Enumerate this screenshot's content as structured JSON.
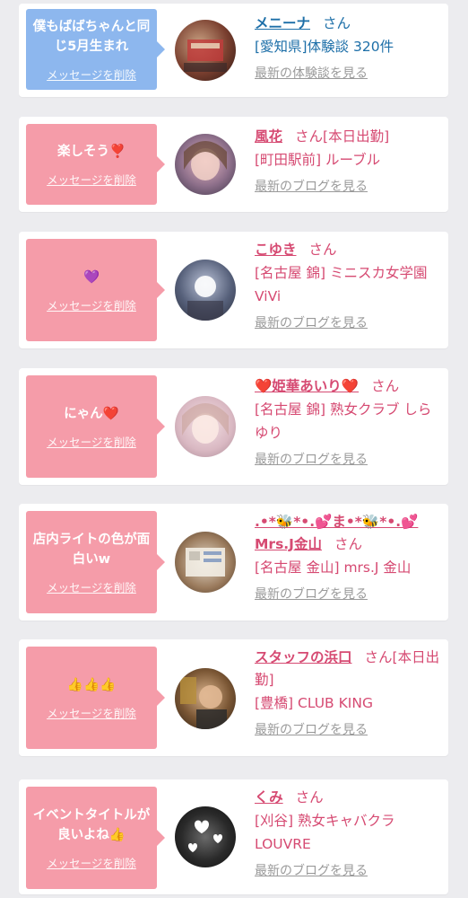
{
  "cards": [
    {
      "message": "僕もばばちゃんと同じ5月生まれ",
      "delete_label": "メッセージを削除",
      "name": "メニーナ",
      "honorific": "さん",
      "shop": "[愛知県]体験談 320件",
      "latest_link": "最新の体験談を見る"
    },
    {
      "message": "楽しそう❣️",
      "delete_label": "メッセージを削除",
      "name": "風花",
      "honorific": "さん[本日出勤]",
      "shop": "[町田駅前] ルーブル",
      "latest_link": "最新のブログを見る"
    },
    {
      "message": "💜",
      "delete_label": "メッセージを削除",
      "name": "こゆき",
      "honorific": "さん",
      "shop": "[名古屋 錦] ミニスカ女学園ViVi",
      "latest_link": "最新のブログを見る"
    },
    {
      "message": "にゃん❤️",
      "delete_label": "メッセージを削除",
      "name": "❤️姫華あいり❤️",
      "honorific": "さん",
      "shop": "[名古屋 錦] 熟女クラブ しらゆり",
      "latest_link": "最新のブログを見る"
    },
    {
      "message": "店内ライトの色が面白いw",
      "delete_label": "メッセージを削除",
      "name": ".•*🐝*•.💕ま•*🐝*•.💕 Mrs.J金山",
      "honorific": "さん",
      "shop": "[名古屋 金山] mrs.J 金山",
      "latest_link": "最新のブログを見る"
    },
    {
      "message": "👍👍👍",
      "delete_label": "メッセージを削除",
      "name": "スタッフの浜口",
      "honorific": "さん[本日出勤]",
      "shop": "[豊橋] CLUB KING",
      "latest_link": "最新のブログを見る"
    },
    {
      "message": "イベントタイトルが良いよね👍",
      "delete_label": "メッセージを削除",
      "name": "くみ",
      "honorific": "さん",
      "shop": "[刈谷] 熟女キャバクラ LOUVRE",
      "latest_link": "最新のブログを見る"
    }
  ]
}
